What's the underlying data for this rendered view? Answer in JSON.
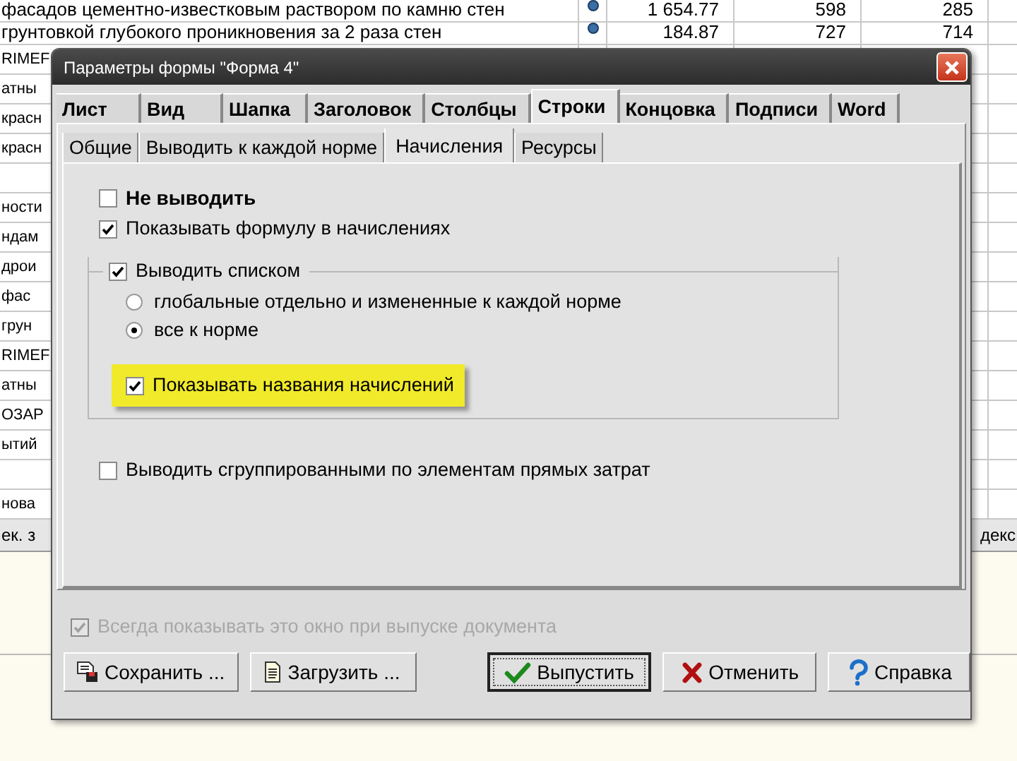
{
  "sheet": {
    "rows": [
      {
        "text": "фасадов цементно-известковым раствором по камню стен",
        "values": [
          "1 654.77",
          "598",
          "285"
        ]
      },
      {
        "text": "грунтовкой глубокого проникновения за 2 раза стен",
        "values": [
          "184.87",
          "727",
          "714"
        ]
      },
      {
        "text": "RIMEF"
      },
      {
        "text": "атны"
      },
      {
        "text": "красн"
      },
      {
        "text": "красн"
      },
      {},
      {
        "text": "ности"
      },
      {
        "text": "ндам"
      },
      {
        "text": "дрои"
      },
      {
        "text": "фас"
      },
      {
        "text": "грун"
      },
      {
        "text": "RIMEF"
      },
      {
        "text": "атны"
      },
      {
        "text": "ОЗАР"
      },
      {
        "text": "ытий"
      },
      {},
      {
        "text": "нова"
      }
    ],
    "footer": {
      "left": "ек. з",
      "right": "декс"
    }
  },
  "dialog": {
    "title": "Параметры формы \"Форма 4\"",
    "tabs": [
      {
        "label": "Лист",
        "selected": false
      },
      {
        "label": "Вид",
        "selected": false
      },
      {
        "label": "Шапка",
        "selected": false
      },
      {
        "label": "Заголовок",
        "selected": false
      },
      {
        "label": "Столбцы",
        "selected": false
      },
      {
        "label": "Строки",
        "selected": true
      },
      {
        "label": "Концовка",
        "selected": false
      },
      {
        "label": "Подписи",
        "selected": false
      },
      {
        "label": "Word",
        "selected": false
      }
    ],
    "subtabs": [
      {
        "label": "Общие",
        "selected": false
      },
      {
        "label": "Выводить к каждой норме",
        "selected": false
      },
      {
        "label": "Начисления",
        "selected": true
      },
      {
        "label": "Ресурсы",
        "selected": false
      }
    ],
    "options": [
      {
        "kind": "checkbox",
        "label": "Не выводить",
        "checked": false,
        "bold": true
      },
      {
        "kind": "checkbox",
        "label": "Показывать формулу в начислениях",
        "checked": true,
        "bold": false
      },
      {
        "kind": "group",
        "label": "Выводить списком",
        "checked": true,
        "children": [
          {
            "kind": "radio",
            "label": "глобальные отдельно и измененные к каждой норме",
            "selected": false
          },
          {
            "kind": "radio",
            "label": "все к норме",
            "selected": true
          },
          {
            "kind": "checkbox",
            "label": "Показывать названия начислений",
            "checked": true,
            "bold": false,
            "highlighted": true
          }
        ]
      },
      {
        "kind": "checkbox",
        "label": "Выводить сгруппированными по элементам прямых затрат",
        "checked": false,
        "bold": false
      }
    ],
    "always_show": {
      "label": "Всегда показывать это окно при выпуске документа",
      "checked": true,
      "disabled": true
    },
    "buttons": [
      {
        "label": "Сохранить ...",
        "kind": "save",
        "default": false
      },
      {
        "label": "Загрузить ...",
        "kind": "load",
        "default": false
      },
      {
        "label": "Выпустить",
        "kind": "ok",
        "default": true
      },
      {
        "label": "Отменить",
        "kind": "cancel",
        "default": false
      },
      {
        "label": "Справка",
        "kind": "help",
        "default": false
      }
    ]
  }
}
